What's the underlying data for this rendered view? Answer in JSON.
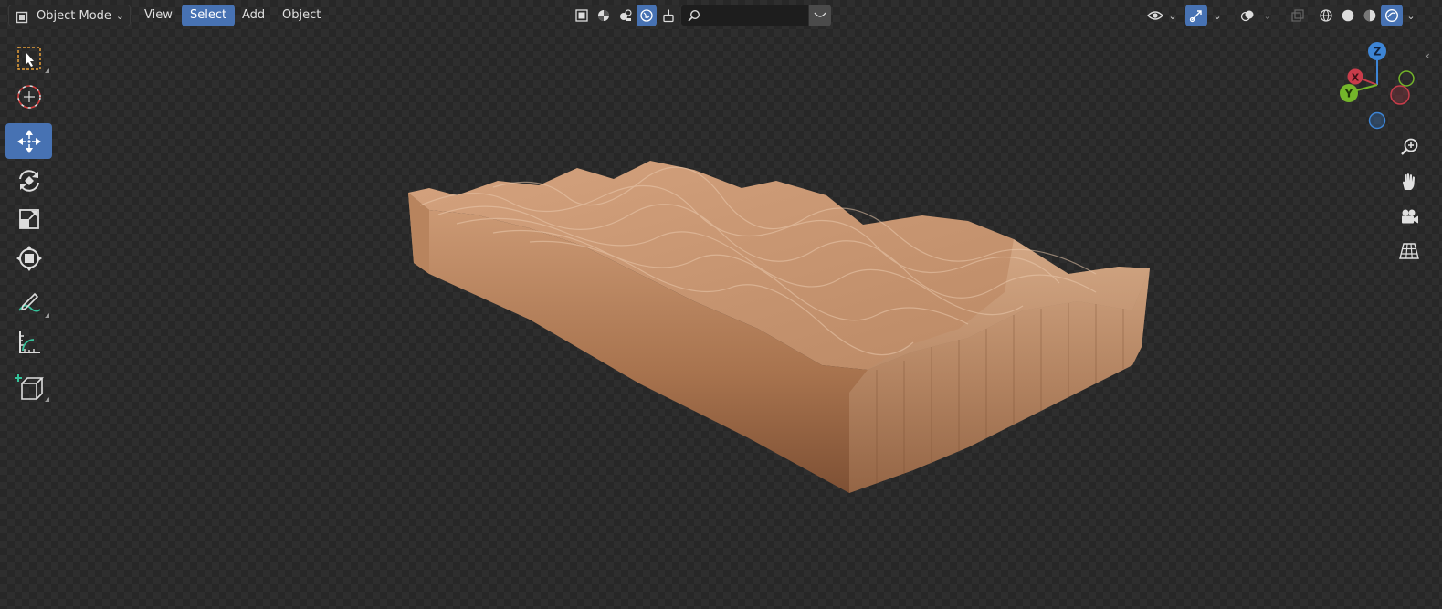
{
  "header": {
    "mode": "Object Mode",
    "menus": [
      "View",
      "Select",
      "Add",
      "Object"
    ],
    "active_menu": "Select",
    "search": {
      "value": "",
      "placeholder": ""
    }
  },
  "toolbar": {
    "tools": [
      "select-box",
      "cursor",
      "move",
      "rotate",
      "scale",
      "transform",
      "annotate",
      "measure",
      "add-cube"
    ],
    "active_tool": "move"
  },
  "gizmo": {
    "axes": [
      "Z",
      "X",
      "Y"
    ]
  },
  "colors": {
    "accent": "#4772b3",
    "axis_x": "#c83c4a",
    "axis_y": "#74b52a",
    "axis_z": "#3d85d6",
    "model_light": "#d7a885",
    "model_dark": "#8a5a3c"
  }
}
